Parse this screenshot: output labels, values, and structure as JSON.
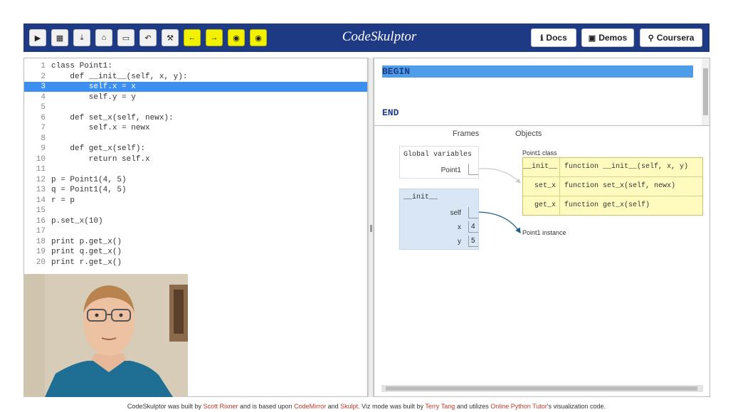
{
  "app": {
    "title": "CodeSkulptor"
  },
  "toolbar": {
    "buttons": [
      {
        "name": "run-button",
        "icon": "▶",
        "style": "normal"
      },
      {
        "name": "save-button",
        "icon": "▦",
        "style": "normal"
      },
      {
        "name": "download-button",
        "icon": "⤓",
        "style": "normal"
      },
      {
        "name": "fresh-url-button",
        "icon": "⌂",
        "style": "normal"
      },
      {
        "name": "open-local-button",
        "icon": "▭",
        "style": "normal"
      },
      {
        "name": "reset-button",
        "icon": "↶",
        "style": "normal"
      },
      {
        "name": "wrench-button",
        "icon": "⚒",
        "style": "normal"
      },
      {
        "name": "viz-step-back-button",
        "icon": "←",
        "style": "yellow"
      },
      {
        "name": "viz-step-forward-button",
        "icon": "→",
        "style": "yellow"
      },
      {
        "name": "viz-first-button",
        "icon": "◉",
        "style": "yellow"
      },
      {
        "name": "viz-last-button",
        "icon": "◉",
        "style": "yellow"
      }
    ],
    "nav": [
      {
        "name": "docs-button",
        "icon": "ℹ",
        "label": "Docs"
      },
      {
        "name": "demos-button",
        "icon": "▣",
        "label": "Demos"
      },
      {
        "name": "coursera-button",
        "icon": "⚲",
        "label": "Coursera"
      }
    ]
  },
  "editor": {
    "highlighted_line": 3,
    "lines": [
      "class Point1:",
      "    def __init__(self, x, y):",
      "        self.x = x",
      "        self.y = y",
      "",
      "    def set_x(self, newx):",
      "        self.x = newx",
      "",
      "    def get_x(self):",
      "        return self.x",
      "",
      "p = Point1(4, 5)",
      "q = Point1(4, 5)",
      "r = p",
      "",
      "p.set_x(10)",
      "",
      "print p.get_x()",
      "print q.get_x()",
      "print r.get_x()"
    ]
  },
  "output": {
    "begin": "BEGIN",
    "end": "END"
  },
  "viz": {
    "frames_header": "Frames",
    "objects_header": "Objects",
    "global_frame": {
      "title": "Global variables",
      "vars": [
        "Point1"
      ]
    },
    "init_frame": {
      "title": "__init__",
      "vars": [
        {
          "name": "self",
          "value": ""
        },
        {
          "name": "x",
          "value": "4"
        },
        {
          "name": "y",
          "value": "5"
        }
      ]
    },
    "class_object": {
      "title": "Point1 class",
      "rows": [
        {
          "key": "__init__",
          "value": "function __init__(self, x, y)"
        },
        {
          "key": "set_x",
          "value": "function set_x(self, newx)"
        },
        {
          "key": "get_x",
          "value": "function get_x(self)"
        }
      ]
    },
    "instance_label": "Point1 instance"
  },
  "footer": {
    "t1": "CodeSkulptor was built by ",
    "l1": "Scott Rixner",
    "t2": " and is based upon ",
    "l2": "CodeMirror",
    "t3": " and ",
    "l3": "Skulpt",
    "t4": ". Viz mode was built by ",
    "l4": "Terry Tang",
    "t5": " and utilizes ",
    "l5": "Online Python Tutor",
    "t6": "'s visualization code."
  },
  "colors": {
    "topbar": "#1f3a85",
    "highlight": "#3c8ff0",
    "frame_bg": "#d8e6f6",
    "class_bg": "#fffbbf",
    "link": "#c0392b"
  }
}
